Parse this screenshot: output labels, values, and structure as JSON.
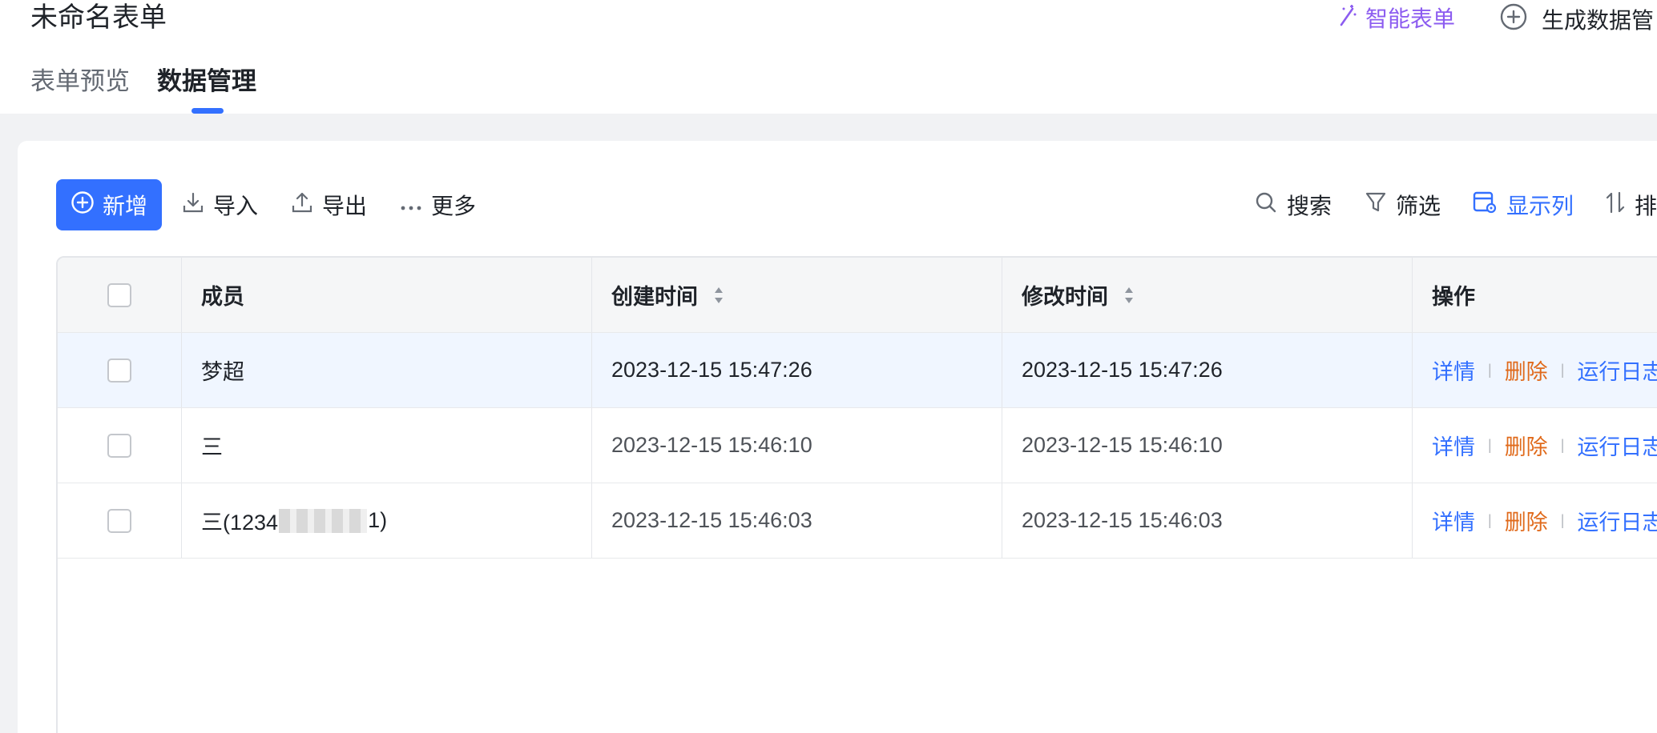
{
  "header": {
    "title": "未命名表单",
    "smart_form": "智能表单",
    "generate": "生成数据管"
  },
  "tabs": [
    {
      "label": "表单预览",
      "active": false
    },
    {
      "label": "数据管理",
      "active": true
    }
  ],
  "toolbar": {
    "add": "新增",
    "import": "导入",
    "export": "导出",
    "more": "更多",
    "search": "搜索",
    "filter": "筛选",
    "columns": "显示列",
    "sort": "排"
  },
  "table": {
    "columns": [
      "成员",
      "创建时间",
      "修改时间",
      "操作"
    ],
    "rows": [
      {
        "member": "梦超",
        "created": "2023-12-15 15:47:26",
        "modified": "2023-12-15 15:47:26",
        "highlighted": true
      },
      {
        "member": "三",
        "created": "2023-12-15 15:46:10",
        "modified": "2023-12-15 15:46:10",
        "highlighted": false
      },
      {
        "member_prefix": "三(1234",
        "member_suffix": "1)",
        "created": "2023-12-15 15:46:03",
        "modified": "2023-12-15 15:46:03",
        "highlighted": false
      }
    ],
    "actions": {
      "detail": "详情",
      "delete": "删除",
      "log": "运行日志"
    }
  },
  "colors": {
    "accent": "#3370ff",
    "danger": "#e06a1b",
    "smart": "#8c5cf0"
  }
}
